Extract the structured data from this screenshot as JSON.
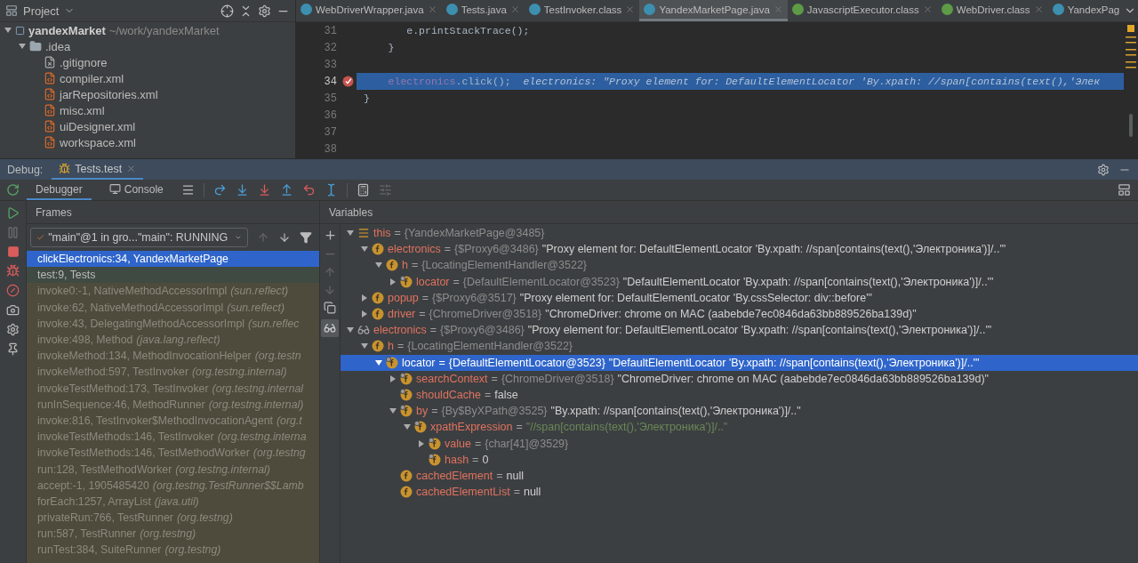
{
  "project_panel": {
    "title": "Project",
    "tree": [
      {
        "name": "yandexMarket",
        "path": "~/work/yandexMarket",
        "kind": "module",
        "expanded": true,
        "children": [
          {
            "name": ".idea",
            "kind": "folder",
            "expanded": true,
            "children": [
              {
                "name": ".gitignore",
                "kind": "ignore"
              },
              {
                "name": "compiler.xml",
                "kind": "xml"
              },
              {
                "name": "jarRepositories.xml",
                "kind": "xml"
              },
              {
                "name": "misc.xml",
                "kind": "xml"
              },
              {
                "name": "uiDesigner.xml",
                "kind": "xml"
              },
              {
                "name": "workspace.xml",
                "kind": "xml"
              }
            ]
          }
        ]
      }
    ]
  },
  "editor": {
    "tabs": [
      {
        "label": "WebDriverWrapper.java",
        "kind": "class",
        "selected": false
      },
      {
        "label": "Tests.java",
        "kind": "class",
        "selected": false
      },
      {
        "label": "TestInvoker.class",
        "kind": "class",
        "selected": false
      },
      {
        "label": "YandexMarketPage.java",
        "kind": "class",
        "selected": true
      },
      {
        "label": "JavascriptExecutor.class",
        "kind": "interface",
        "selected": false
      },
      {
        "label": "WebDriver.class",
        "kind": "interface",
        "selected": false
      },
      {
        "label": "YandexPag",
        "kind": "class",
        "selected": false
      }
    ],
    "lines": [
      {
        "number": "31",
        "breakpoint": false,
        "current": false,
        "segments": [
          {
            "kind": "plain",
            "text": "       e.printStackTrace();"
          }
        ]
      },
      {
        "number": "32",
        "breakpoint": false,
        "current": false,
        "segments": [
          {
            "kind": "plain",
            "text": "    }"
          }
        ]
      },
      {
        "number": "33",
        "breakpoint": false,
        "current": false
      },
      {
        "number": "34",
        "breakpoint": true,
        "current": true,
        "segments": [
          {
            "kind": "field",
            "text": "    electronics"
          },
          {
            "kind": "plain",
            "text": ".click();  "
          },
          {
            "kind": "inline",
            "text": "electronics: \"Proxy element for: DefaultElementLocator 'By.xpath: //span[contains(text(),'Элек"
          }
        ]
      },
      {
        "number": "35",
        "breakpoint": false,
        "current": false,
        "segments": [
          {
            "kind": "plain",
            "text": "}"
          }
        ]
      },
      {
        "number": "36",
        "breakpoint": false,
        "current": false
      },
      {
        "number": "37",
        "breakpoint": false,
        "current": false
      },
      {
        "number": "38",
        "breakpoint": false,
        "current": false
      }
    ]
  },
  "debug": {
    "title": "Debug:",
    "session_tab": "Tests.test",
    "tabs": [
      {
        "label": "Debugger",
        "selected": true
      },
      {
        "label": "Console",
        "selected": false
      }
    ],
    "frames": {
      "title": "Frames",
      "thread": "\"main\"@1 in gro...\"main\": RUNNING",
      "items": [
        {
          "method": "clickElectronics:34, YandexMarketPage",
          "selected": true,
          "library": false
        },
        {
          "method": "test:9, Tests",
          "selected": false,
          "library": false
        },
        {
          "method": "invoke0:-1, NativeMethodAccessorImpl",
          "package": "(sun.reflect)",
          "selected": false,
          "library": true
        },
        {
          "method": "invoke:62, NativeMethodAccessorImpl",
          "package": "(sun.reflect)",
          "selected": false,
          "library": true
        },
        {
          "method": "invoke:43, DelegatingMethodAccessorImpl",
          "package": "(sun.reflec",
          "selected": false,
          "library": true
        },
        {
          "method": "invoke:498, Method",
          "package": "(java.lang.reflect)",
          "selected": false,
          "library": true
        },
        {
          "method": "invokeMethod:134, MethodInvocationHelper",
          "package": "(org.testn",
          "selected": false,
          "library": true
        },
        {
          "method": "invokeMethod:597, TestInvoker",
          "package": "(org.testng.internal)",
          "selected": false,
          "library": true
        },
        {
          "method": "invokeTestMethod:173, TestInvoker",
          "package": "(org.testng.internal",
          "selected": false,
          "library": true
        },
        {
          "method": "runInSequence:46, MethodRunner",
          "package": "(org.testng.internal)",
          "selected": false,
          "library": true
        },
        {
          "method": "invoke:816, TestInvoker$MethodInvocationAgent",
          "package": "(org.t",
          "selected": false,
          "library": true
        },
        {
          "method": "invokeTestMethods:146, TestInvoker",
          "package": "(org.testng.interna",
          "selected": false,
          "library": true
        },
        {
          "method": "invokeTestMethods:146, TestMethodWorker",
          "package": "(org.testng",
          "selected": false,
          "library": true
        },
        {
          "method": "run:128, TestMethodWorker",
          "package": "(org.testng.internal)",
          "selected": false,
          "library": true
        },
        {
          "method": "accept:-1, 1905485420",
          "package": "(org.testng.TestRunner$$Lamb",
          "selected": false,
          "library": true
        },
        {
          "method": "forEach:1257, ArrayList",
          "package": "(java.util)",
          "selected": false,
          "library": true
        },
        {
          "method": "privateRun:766, TestRunner",
          "package": "(org.testng)",
          "selected": false,
          "library": true
        },
        {
          "method": "run:587, TestRunner",
          "package": "(org.testng)",
          "selected": false,
          "library": true
        },
        {
          "method": "runTest:384, SuiteRunner",
          "package": "(org.testng)",
          "selected": false,
          "library": true
        }
      ]
    },
    "variables": {
      "title": "Variables",
      "tree": [
        {
          "name": "this",
          "kind": "object",
          "expanded": true,
          "selected": false,
          "separator": "=",
          "ref": "{YandexMarketPage@3485}",
          "children": [
            {
              "name": "electronics",
              "kind": "field",
              "expanded": true,
              "selected": false,
              "separator": "=",
              "ref": "{$Proxy6@3486}",
              "value": "\"Proxy element for: DefaultElementLocator 'By.xpath: //span[contains(text(),'Электроника')]/..'\"",
              "children": [
                {
                  "name": "h",
                  "kind": "field",
                  "expanded": true,
                  "selected": false,
                  "separator": "=",
                  "ref": "{LocatingElementHandler@3522}",
                  "children": [
                    {
                      "name": "locator",
                      "kind": "final_field",
                      "expanded": false,
                      "selected": false,
                      "separator": "=",
                      "ref": "{DefaultElementLocator@3523}",
                      "value": "\"DefaultElementLocator 'By.xpath: //span[contains(text(),'Электроника')]/..'\""
                    }
                  ]
                }
              ]
            },
            {
              "name": "popup",
              "kind": "field",
              "expanded": false,
              "selected": false,
              "separator": "=",
              "ref": "{$Proxy6@3517}",
              "value": "\"Proxy element for: DefaultElementLocator 'By.cssSelector: div::before'\""
            },
            {
              "name": "driver",
              "kind": "field",
              "expanded": false,
              "selected": false,
              "separator": "=",
              "ref": "{ChromeDriver@3518}",
              "value": "\"ChromeDriver: chrome on MAC (aabebde7ec0846da63bb889526ba139d)\""
            }
          ]
        },
        {
          "name": "electronics",
          "kind": "watch",
          "expanded": true,
          "selected": false,
          "separator": "=",
          "ref": "{$Proxy6@3486}",
          "value": "\"Proxy element for: DefaultElementLocator 'By.xpath: //span[contains(text(),'Электроника')]/..'\"",
          "children": [
            {
              "name": "h",
              "kind": "field",
              "expanded": true,
              "selected": false,
              "separator": "=",
              "ref": "{LocatingElementHandler@3522}",
              "children": [
                {
                  "name": "locator",
                  "kind": "final_field",
                  "expanded": true,
                  "selected": true,
                  "separator": "=",
                  "ref": "{DefaultElementLocator@3523}",
                  "value": "\"DefaultElementLocator 'By.xpath: //span[contains(text(),'Электроника')]/..'\"",
                  "children": [
                    {
                      "name": "searchContext",
                      "kind": "final_field",
                      "expanded": false,
                      "selected": false,
                      "separator": "=",
                      "ref": "{ChromeDriver@3518}",
                      "value": "\"ChromeDriver: chrome on MAC (aabebde7ec0846da63bb889526ba139d)\""
                    },
                    {
                      "name": "shouldCache",
                      "kind": "final_field",
                      "selected": false,
                      "separator": "=",
                      "value": "false"
                    },
                    {
                      "name": "by",
                      "kind": "final_field",
                      "expanded": true,
                      "selected": false,
                      "separator": "=",
                      "ref": "{By$ByXPath@3525}",
                      "value": "\"By.xpath: //span[contains(text(),'Электроника')]/..\"",
                      "children": [
                        {
                          "name": "xpathExpression",
                          "kind": "final_field",
                          "expanded": true,
                          "selected": false,
                          "separator": "=",
                          "literal": "\"//span[contains(text(),'Электроника')]/..\"",
                          "children": [
                            {
                              "name": "value",
                              "kind": "final_field",
                              "expanded": false,
                              "selected": false,
                              "separator": "=",
                              "ref": "{char[41]@3529}"
                            },
                            {
                              "name": "hash",
                              "kind": "final_field",
                              "selected": false,
                              "separator": "=",
                              "value": "0"
                            }
                          ]
                        }
                      ]
                    },
                    {
                      "name": "cachedElement",
                      "kind": "field",
                      "selected": false,
                      "separator": "=",
                      "value": "null"
                    },
                    {
                      "name": "cachedElementList",
                      "kind": "field",
                      "selected": false,
                      "separator": "=",
                      "value": "null"
                    }
                  ]
                }
              ]
            }
          ]
        }
      ]
    }
  }
}
